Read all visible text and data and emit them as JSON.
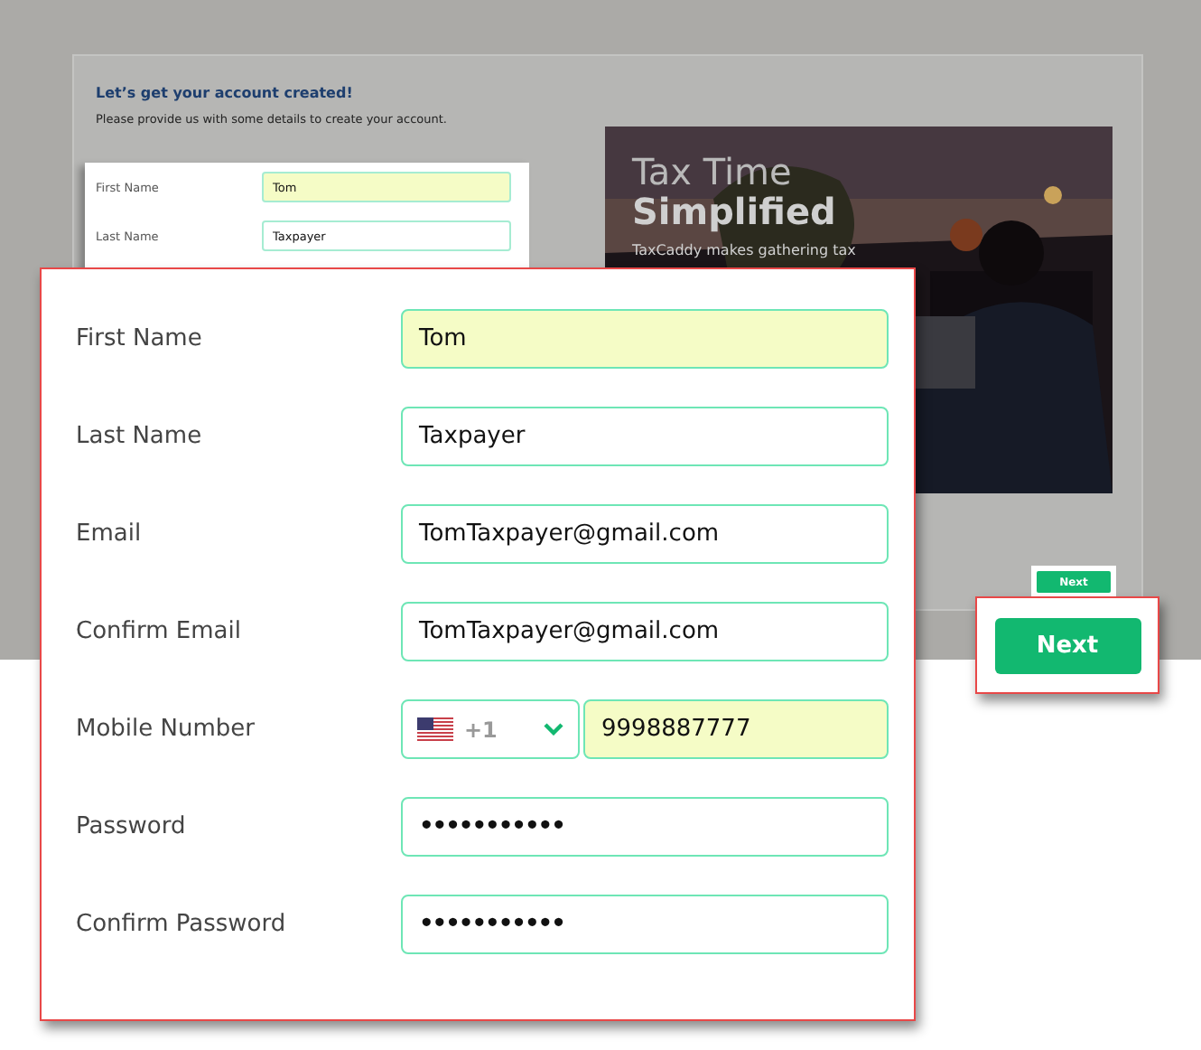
{
  "background_page": {
    "heading": "Let’s get your account created!",
    "subtitle": "Please provide us with some details to create your account.",
    "form_fields": [
      {
        "label": "First Name",
        "value": "Tom",
        "autofilled": true
      },
      {
        "label": "Last Name",
        "value": "Taxpayer",
        "autofilled": false
      }
    ],
    "promo": {
      "kind": "picture",
      "title_line_1": "Tax Time",
      "title_line_2": "Simplified",
      "text": "TaxCaddy makes gathering tax"
    },
    "next_button": "Next"
  },
  "form_callout": {
    "fields": [
      {
        "kind": "text",
        "label": "First Name",
        "value": "Tom",
        "autofilled": true
      },
      {
        "kind": "text",
        "label": "Last Name",
        "value": "Taxpayer",
        "autofilled": false
      },
      {
        "kind": "text",
        "label": "Email",
        "value": "TomTaxpayer@gmail.com",
        "autofilled": false
      },
      {
        "kind": "text",
        "label": "Confirm Email",
        "value": "TomTaxpayer@gmail.com",
        "autofilled": false
      },
      {
        "kind": "phone",
        "label": "Mobile Number",
        "country_code": "+1",
        "value": "9998887777",
        "autofilled": true
      },
      {
        "kind": "password",
        "label": "Password",
        "value": "•••••••••••",
        "autofilled": false
      },
      {
        "kind": "password",
        "label": "Confirm Password",
        "value": "•••••••••••",
        "autofilled": false
      }
    ]
  },
  "next_callout": {
    "button": "Next"
  }
}
